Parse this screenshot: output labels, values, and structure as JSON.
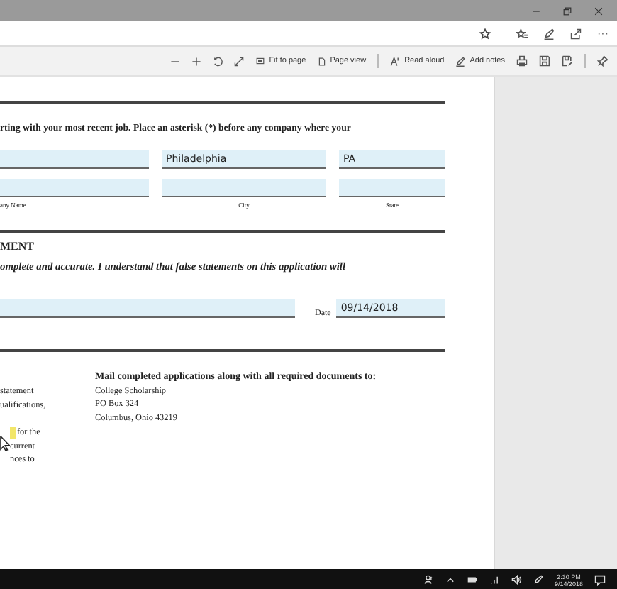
{
  "address_bar": {
    "more": "···"
  },
  "toolbar": {
    "fit_to_page": "Fit to page",
    "page_view": "Page view",
    "read_aloud": "Read aloud",
    "add_notes": "Add notes"
  },
  "document": {
    "intro": "rting with your most recent job. Place an asterisk (*) before any company where your",
    "first_row": {
      "city": "Philadelphia",
      "state": "PA"
    },
    "field_labels": [
      "any Name",
      "City",
      "State"
    ],
    "section_heading": "MENT",
    "statement": "omplete and accurate. I understand that false statements on this application will",
    "date_label": "Date",
    "date_value": "09/14/2018",
    "left_fragments": [
      "statement",
      "ualifications,",
      "for the",
      "current",
      "nces to"
    ],
    "mail_heading": "Mail completed applications along with all required documents to:",
    "address_lines": [
      "College Scholarship",
      "PO Box 324",
      "Columbus, Ohio 43219"
    ]
  },
  "taskbar": {
    "time": "2:30 PM",
    "date": "9/14/2018"
  }
}
